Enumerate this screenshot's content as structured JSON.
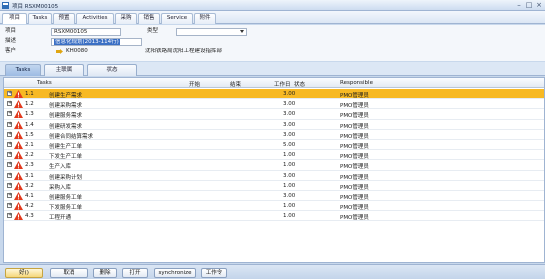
{
  "window": {
    "title": "项目 RSXM00105"
  },
  "tabs": [
    {
      "label": "项目",
      "active": true
    },
    {
      "label": "Tasks",
      "active": false
    },
    {
      "label": "预置",
      "active": false
    },
    {
      "label": "Activities",
      "active": false
    },
    {
      "label": "采购",
      "active": false
    },
    {
      "label": "销售",
      "active": false
    },
    {
      "label": "Service",
      "active": false
    },
    {
      "label": "附件",
      "active": false
    }
  ],
  "header": {
    "project_label": "项目",
    "project_value": "RSXM00105",
    "type_label": "类型",
    "type_value": "",
    "description_label": "描述",
    "description_value": "信息化规划(2013-114行)",
    "customer_label": "客户",
    "customer_code": "KH0080",
    "customer_name": "沈阳铁路局沈阳工程建设指挥部"
  },
  "subtabs": [
    {
      "label": "Tasks",
      "active": true
    },
    {
      "label": "主联属",
      "active": false
    },
    {
      "label": "状态",
      "active": false
    }
  ],
  "grid": {
    "columns": {
      "tasks": "Tasks",
      "start": "开始",
      "end": "结束",
      "workdays": "工作日",
      "status": "状态",
      "responsible": "Responsible"
    },
    "rows": [
      {
        "num": "1.1",
        "name": "创建生产需求",
        "workdays": "3.00",
        "responsible": "PMO管理员",
        "selected": true
      },
      {
        "num": "1.2",
        "name": "创建采购需求",
        "workdays": "3.00",
        "responsible": "PMO管理员",
        "selected": false
      },
      {
        "num": "1.3",
        "name": "创建服务需求",
        "workdays": "3.00",
        "responsible": "PMO管理员",
        "selected": false
      },
      {
        "num": "1.4",
        "name": "创建研发需求",
        "workdays": "3.00",
        "responsible": "PMO管理员",
        "selected": false
      },
      {
        "num": "1.5",
        "name": "创建合同结算需求",
        "workdays": "3.00",
        "responsible": "PMO管理员",
        "selected": false
      },
      {
        "num": "2.1",
        "name": "创建生产工单",
        "workdays": "5.00",
        "responsible": "PMO管理员",
        "selected": false
      },
      {
        "num": "2.2",
        "name": "下发生产工单",
        "workdays": "1.00",
        "responsible": "PMO管理员",
        "selected": false
      },
      {
        "num": "2.3",
        "name": "生产入库",
        "workdays": "1.00",
        "responsible": "PMO管理员",
        "selected": false
      },
      {
        "num": "3.1",
        "name": "创建采购计划",
        "workdays": "3.00",
        "responsible": "PMO管理员",
        "selected": false
      },
      {
        "num": "3.2",
        "name": "采购入库",
        "workdays": "1.00",
        "responsible": "PMO管理员",
        "selected": false
      },
      {
        "num": "4.1",
        "name": "创建服务工单",
        "workdays": "3.00",
        "responsible": "PMO管理员",
        "selected": false
      },
      {
        "num": "4.2",
        "name": "下发服务工单",
        "workdays": "1.00",
        "responsible": "PMO管理员",
        "selected": false
      },
      {
        "num": "4.3",
        "name": "工程开通",
        "workdays": "1.00",
        "responsible": "PMO管理员",
        "selected": false
      }
    ]
  },
  "buttons": {
    "ok": "好()",
    "cancel": "取消",
    "delete": "删除",
    "open": "打开",
    "synchronize": "synchronize",
    "work_order": "工作令"
  },
  "colors": {
    "selected_row": "#f7b924",
    "warning": "#e23a1e",
    "accent": "#3a6fc4"
  }
}
